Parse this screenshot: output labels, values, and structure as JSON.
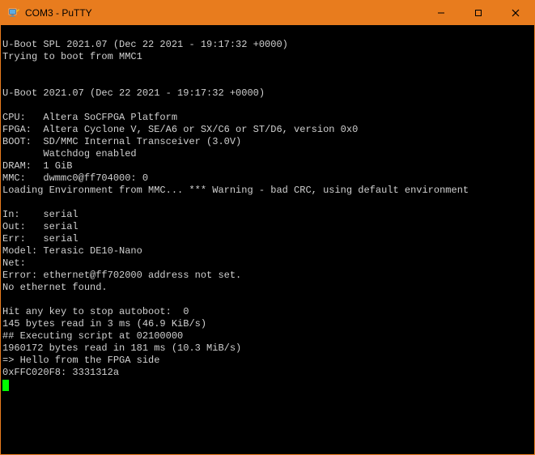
{
  "titlebar": {
    "icon_name": "putty-icon",
    "title": "COM3 - PuTTY",
    "minimize": "—",
    "maximize": "☐",
    "close": "✕"
  },
  "terminal": {
    "lines": [
      "",
      "U-Boot SPL 2021.07 (Dec 22 2021 - 19:17:32 +0000)",
      "Trying to boot from MMC1",
      "",
      "",
      "U-Boot 2021.07 (Dec 22 2021 - 19:17:32 +0000)",
      "",
      "CPU:   Altera SoCFPGA Platform",
      "FPGA:  Altera Cyclone V, SE/A6 or SX/C6 or ST/D6, version 0x0",
      "BOOT:  SD/MMC Internal Transceiver (3.0V)",
      "       Watchdog enabled",
      "DRAM:  1 GiB",
      "MMC:   dwmmc0@ff704000: 0",
      "Loading Environment from MMC... *** Warning - bad CRC, using default environment",
      "",
      "In:    serial",
      "Out:   serial",
      "Err:   serial",
      "Model: Terasic DE10-Nano",
      "Net:",
      "Error: ethernet@ff702000 address not set.",
      "No ethernet found.",
      "",
      "Hit any key to stop autoboot:  0",
      "145 bytes read in 3 ms (46.9 KiB/s)",
      "## Executing script at 02100000",
      "1960172 bytes read in 181 ms (10.3 MiB/s)",
      "=> Hello from the FPGA side",
      "0xFFC020F8: 3331312a"
    ]
  }
}
